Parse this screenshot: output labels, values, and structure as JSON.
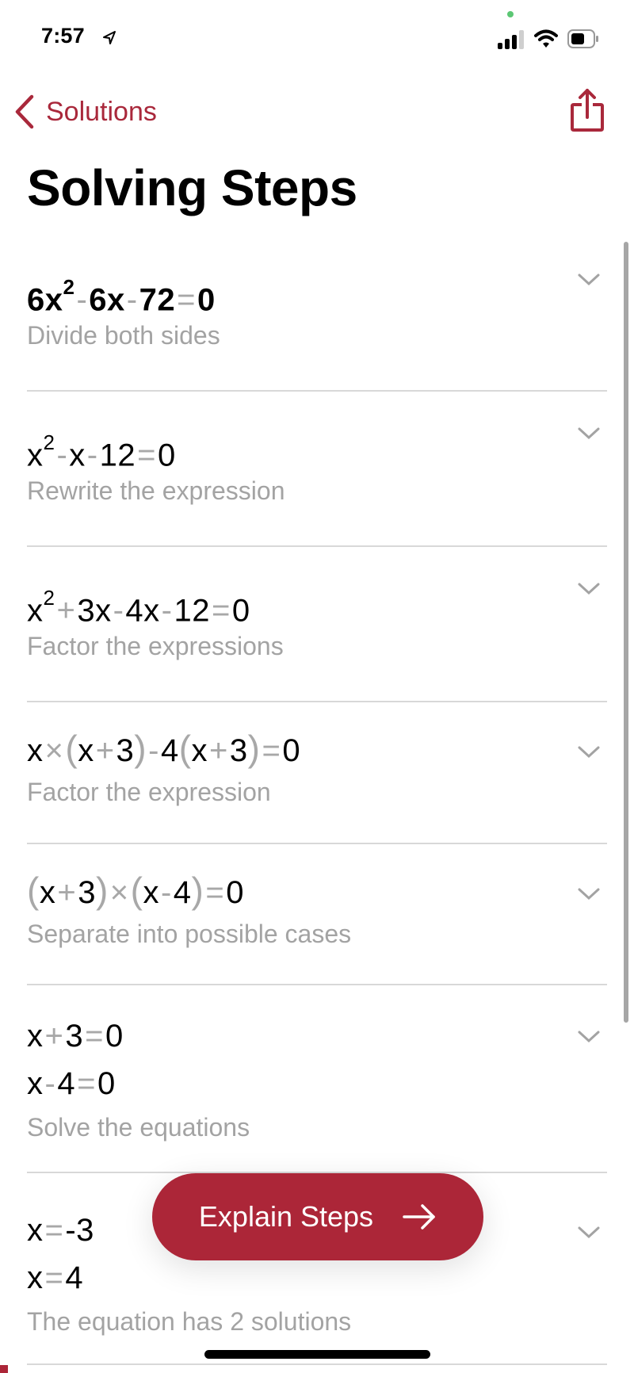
{
  "status_bar": {
    "time": "7:57",
    "location_icon": "location-arrow-icon",
    "signal_icon": "cellular-signal-icon",
    "wifi_icon": "wifi-icon",
    "battery_icon": "battery-icon"
  },
  "nav": {
    "back_label": "Solutions",
    "back_icon": "chevron-left-icon",
    "share_icon": "share-icon"
  },
  "page_title": "Solving Steps",
  "colors": {
    "accent": "#ac2638",
    "operator": "#a8a8a8",
    "description": "#a3a3a3",
    "divider": "#d8d8d8"
  },
  "steps": [
    {
      "expression": [
        "6x² - 6x - 72 = 0"
      ],
      "description": "Divide both sides"
    },
    {
      "expression": [
        "x² - x - 12 = 0"
      ],
      "description": "Rewrite the expression"
    },
    {
      "expression": [
        "x² + 3x - 4x - 12 = 0"
      ],
      "description": "Factor the expressions"
    },
    {
      "expression": [
        "x × (x + 3) - 4(x + 3) = 0"
      ],
      "description": "Factor the expression"
    },
    {
      "expression": [
        "(x + 3) × (x - 4) = 0"
      ],
      "description": "Separate into possible cases"
    },
    {
      "expression": [
        "x + 3 = 0",
        "x - 4 = 0"
      ],
      "description": "Solve the equations"
    },
    {
      "expression": [
        "x = -3",
        "x = 4"
      ],
      "description": "The equation has 2 solutions"
    }
  ],
  "explain_button": {
    "label": "Explain Steps",
    "icon": "arrow-right-icon"
  }
}
